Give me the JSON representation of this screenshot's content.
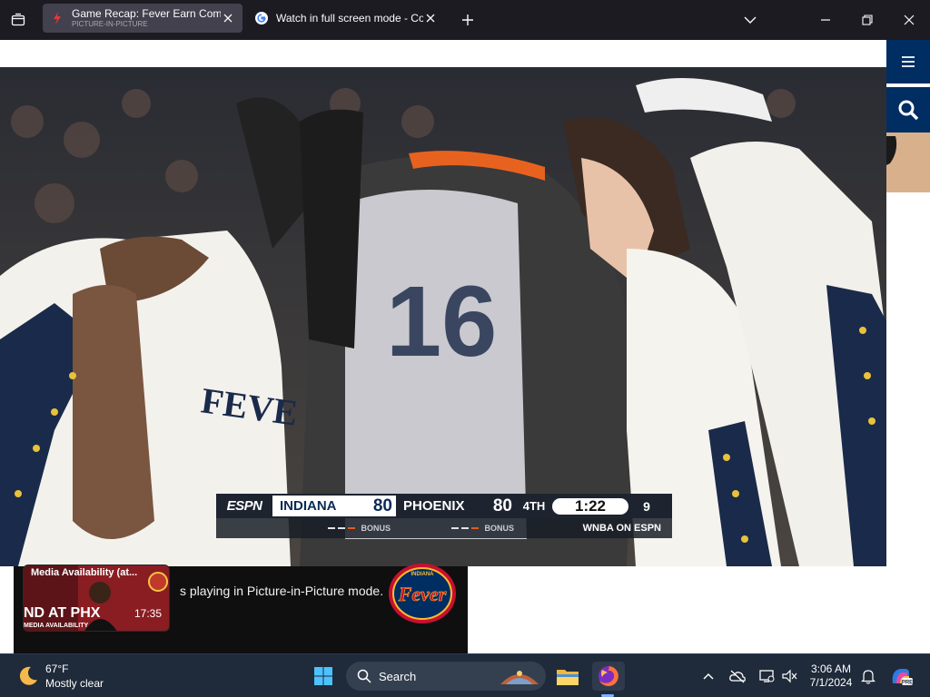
{
  "browser": {
    "tabs": [
      {
        "title": "Game Recap: Fever Earn Come",
        "subtitle": "PICTURE-IN-PICTURE",
        "active": true
      },
      {
        "title": "Watch in full screen mode - Co",
        "active": false
      }
    ]
  },
  "video": {
    "scorebug": {
      "network": "ESPN",
      "home_team": "INDIANA",
      "home_score": "80",
      "away_team": "PHOENIX",
      "away_score": "80",
      "period": "4TH",
      "clock": "1:22",
      "shot_clock": "9",
      "bonus_label": "BONUS",
      "brand": "WNBA ON ESPN"
    }
  },
  "media_panel": {
    "thumbnail_title": "Media Availability (at...",
    "thumbnail_sub": "ND AT PHX",
    "thumbnail_footer": "MEDIA AVAILABILITY",
    "duration": "17:35",
    "pip_message": "s playing in Picture-in-Picture mode.",
    "logo_text": "Fever",
    "logo_top_text": "INDIANA"
  },
  "taskbar": {
    "weather_temp": "67°F",
    "weather_condition": "Mostly clear",
    "search_label": "Search",
    "time": "3:06 AM",
    "date": "7/1/2024"
  },
  "colors": {
    "browser_chrome": "#1c1b22",
    "active_tab": "#42414d",
    "site_nav": "#002d62",
    "taskbar": "#1f2a3a"
  }
}
